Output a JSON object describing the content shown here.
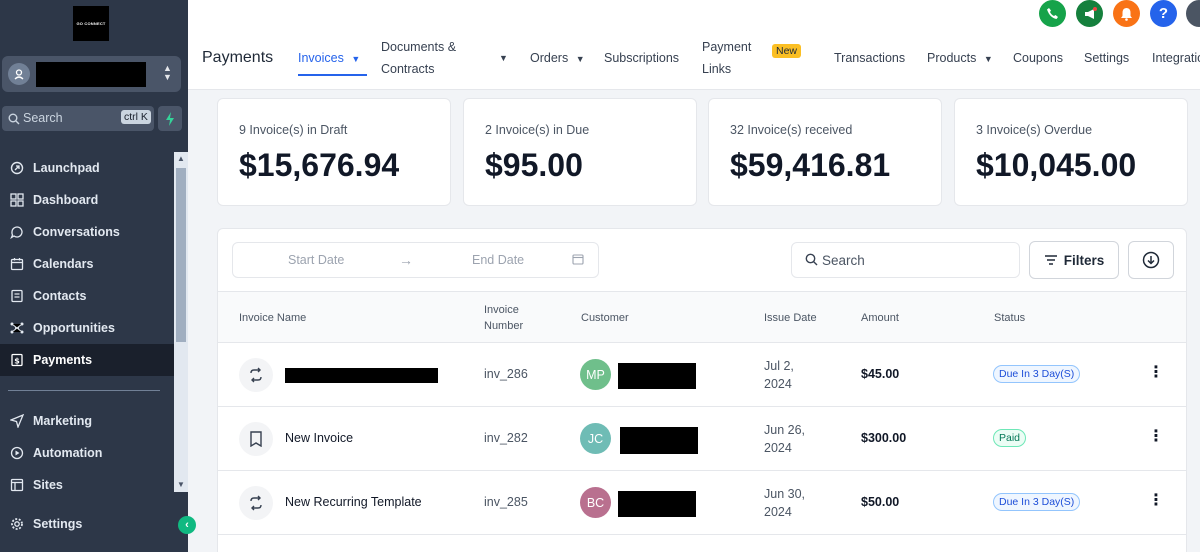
{
  "sidebar": {
    "logo_text": "GO CONNECT",
    "search": {
      "placeholder": "Search",
      "shortcut": "ctrl K"
    },
    "nav_items": [
      {
        "label": "Launchpad",
        "icon": "launchpad-icon"
      },
      {
        "label": "Dashboard",
        "icon": "dashboard-icon"
      },
      {
        "label": "Conversations",
        "icon": "chat-icon"
      },
      {
        "label": "Calendars",
        "icon": "calendar-icon"
      },
      {
        "label": "Contacts",
        "icon": "contacts-icon"
      },
      {
        "label": "Opportunities",
        "icon": "opportunities-icon"
      },
      {
        "label": "Payments",
        "icon": "payments-icon",
        "active": true
      },
      {
        "label": "Marketing",
        "icon": "send-icon"
      },
      {
        "label": "Automation",
        "icon": "automation-icon"
      },
      {
        "label": "Sites",
        "icon": "sites-icon"
      },
      {
        "label": "Settings",
        "icon": "gear-icon"
      }
    ]
  },
  "topbar": {
    "title": "Payments",
    "tabs": {
      "invoices": "Invoices",
      "documents_line1": "Documents &",
      "documents_line2": "Contracts",
      "orders": "Orders",
      "subscriptions": "Subscriptions",
      "payment_links_line1": "Payment",
      "payment_links_line2": "Links",
      "new_badge": "New",
      "transactions": "Transactions",
      "products": "Products",
      "coupons": "Coupons",
      "settings": "Settings",
      "integrations": "Integrations"
    },
    "icons": {
      "phone": "#16a34a",
      "megaphone": "#15803d",
      "bell": "#f97316",
      "help": "#2563eb"
    }
  },
  "stats": [
    {
      "label": "9 Invoice(s) in Draft",
      "value": "$15,676.94"
    },
    {
      "label": "2 Invoice(s) in Due",
      "value": "$95.00"
    },
    {
      "label": "32 Invoice(s) received",
      "value": "$59,416.81"
    },
    {
      "label": "3 Invoice(s) Overdue",
      "value": "$10,045.00"
    }
  ],
  "filters": {
    "start_date": "Start Date",
    "end_date": "End Date",
    "search_placeholder": "Search",
    "filters_label": "Filters"
  },
  "table": {
    "headers": {
      "invoice_name": "Invoice Name",
      "invoice_number_line1": "Invoice",
      "invoice_number_line2": "Number",
      "customer": "Customer",
      "issue_date": "Issue Date",
      "amount": "Amount",
      "status": "Status"
    },
    "rows": [
      {
        "name": "",
        "number": "inv_286",
        "initials": "MP",
        "avatar_color": "#6fbf8b",
        "date_line1": "Jul 2,",
        "date_line2": "2024",
        "amount": "$45.00",
        "status": "Due In 3 Day(S)",
        "status_type": "due",
        "icon": "recurring-icon"
      },
      {
        "name": "New Invoice",
        "number": "inv_282",
        "initials": "JC",
        "avatar_color": "#6fbcb5",
        "date_line1": "Jun 26,",
        "date_line2": "2024",
        "amount": "$300.00",
        "status": "Paid",
        "status_type": "paid",
        "icon": "invoice-icon"
      },
      {
        "name": "New Recurring Template",
        "number": "inv_285",
        "initials": "BC",
        "avatar_color": "#b9708f",
        "date_line1": "Jun 30,",
        "date_line2": "2024",
        "amount": "$50.00",
        "status": "Due In 3 Day(S)",
        "status_type": "due",
        "icon": "recurring-icon"
      }
    ]
  }
}
